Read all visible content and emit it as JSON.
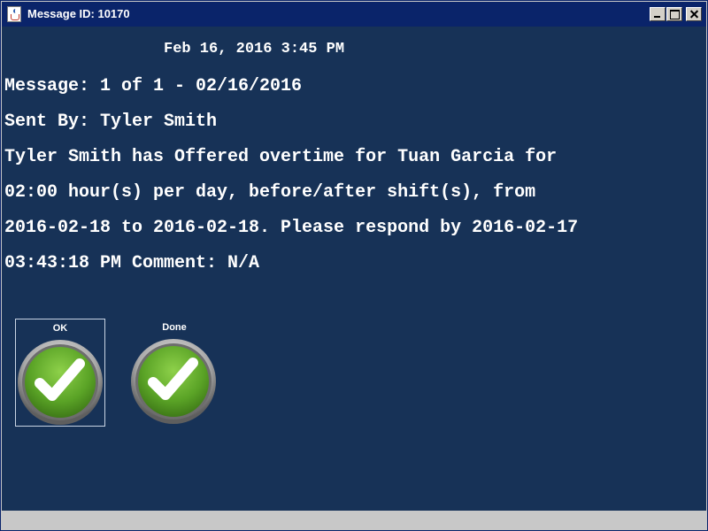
{
  "window": {
    "title": "Message ID: 10170"
  },
  "message": {
    "datetime": "Feb 16, 2016 3:45 PM",
    "lines": [
      "Message: 1 of 1 - 02/16/2016",
      "Sent By: Tyler Smith",
      "Tyler Smith has Offered overtime for Tuan Garcia for",
      "02:00 hour(s) per day, before/after shift(s), from",
      "2016-02-18 to 2016-02-18. Please respond by 2016-02-17",
      "03:43:18 PM Comment: N/A"
    ]
  },
  "buttons": {
    "ok_label": "OK",
    "done_label": "Done",
    "icon": "checkmark-icon"
  },
  "colors": {
    "background": "#173257",
    "titlebar": "#0a246a",
    "check_green": "#5aa326"
  }
}
